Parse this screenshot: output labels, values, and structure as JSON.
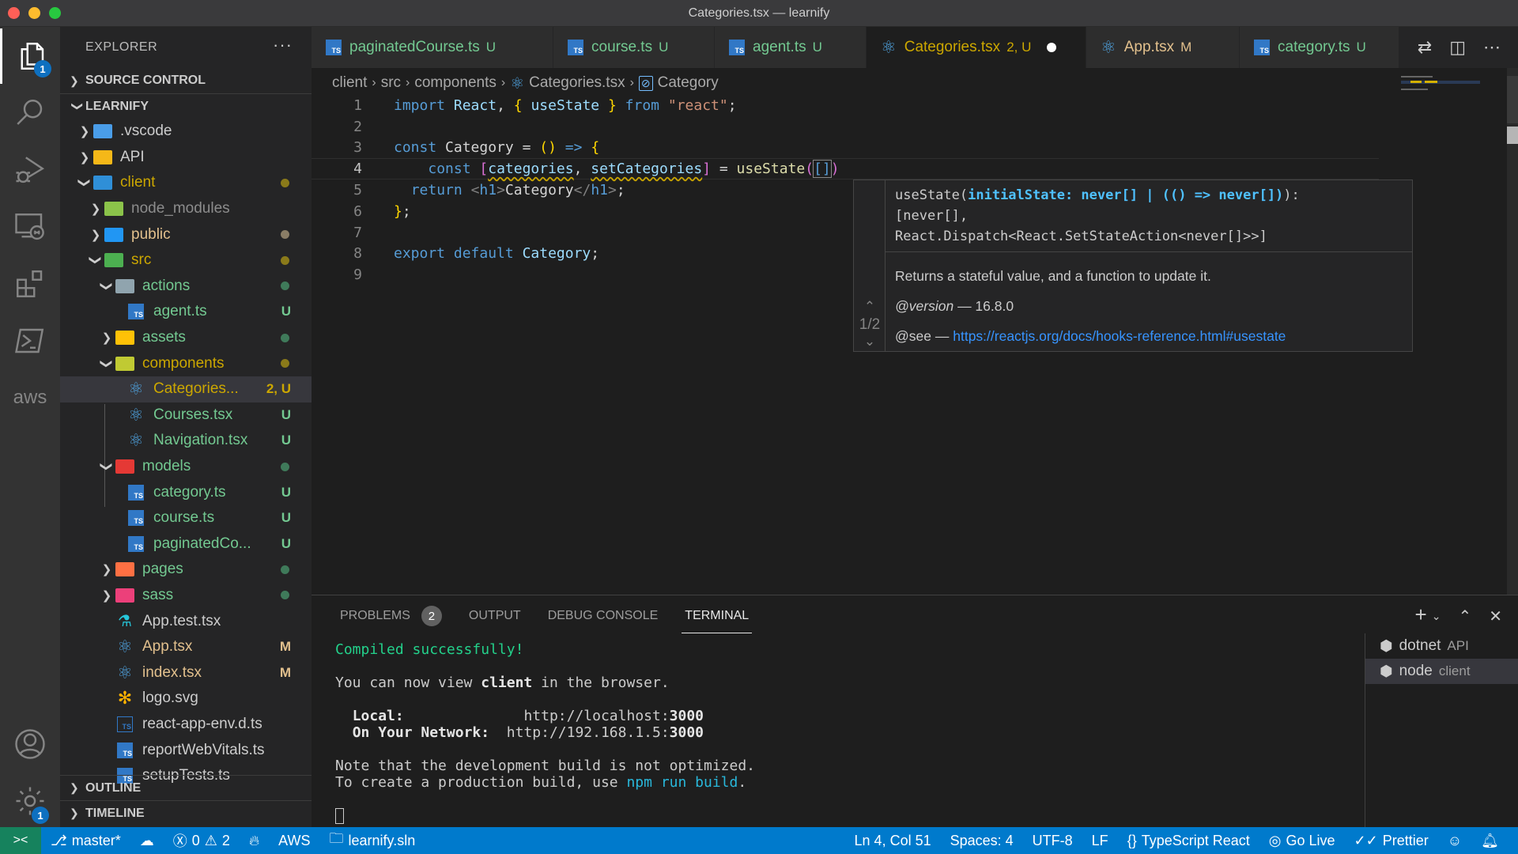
{
  "window": {
    "title": "Categories.tsx — learnify"
  },
  "activity_bar": {
    "explorer_badge": "1",
    "settings_badge": "1",
    "items": [
      "explorer",
      "search",
      "run-debug",
      "remote-explorer",
      "extensions",
      "terminal",
      "aws",
      "accounts",
      "manage"
    ]
  },
  "sidebar": {
    "title": "EXPLORER",
    "more": "···",
    "source_control": "SOURCE CONTROL",
    "project": "LEARNIFY",
    "outline": "OUTLINE",
    "timeline": "TIMELINE",
    "tree": [
      {
        "name": ".vscode",
        "deco": ""
      },
      {
        "name": "API",
        "deco": ""
      },
      {
        "name": "client",
        "deco": "dot"
      },
      {
        "name": "node_modules",
        "deco": ""
      },
      {
        "name": "public",
        "deco": "dot"
      },
      {
        "name": "src",
        "deco": "dot"
      },
      {
        "name": "actions",
        "deco": "dot"
      },
      {
        "name": "agent.ts",
        "deco": "U"
      },
      {
        "name": "assets",
        "deco": "dot"
      },
      {
        "name": "components",
        "deco": "dot"
      },
      {
        "name": "Categories...",
        "deco": "2, U"
      },
      {
        "name": "Courses.tsx",
        "deco": "U"
      },
      {
        "name": "Navigation.tsx",
        "deco": "U"
      },
      {
        "name": "models",
        "deco": "dot"
      },
      {
        "name": "category.ts",
        "deco": "U"
      },
      {
        "name": "course.ts",
        "deco": "U"
      },
      {
        "name": "paginatedCo...",
        "deco": "U"
      },
      {
        "name": "pages",
        "deco": "dot"
      },
      {
        "name": "sass",
        "deco": "dot"
      },
      {
        "name": "App.test.tsx",
        "deco": ""
      },
      {
        "name": "App.tsx",
        "deco": "M"
      },
      {
        "name": "index.tsx",
        "deco": "M"
      },
      {
        "name": "logo.svg",
        "deco": ""
      },
      {
        "name": "react-app-env.d.ts",
        "deco": ""
      },
      {
        "name": "reportWebVitals.ts",
        "deco": ""
      },
      {
        "name": "setupTests.ts",
        "deco": ""
      }
    ]
  },
  "tabs": [
    {
      "label": "paginatedCourse.ts",
      "dec": "U"
    },
    {
      "label": "course.ts",
      "dec": "U"
    },
    {
      "label": "agent.ts",
      "dec": "U"
    },
    {
      "label": "Categories.tsx",
      "dec": "2, U",
      "active": true,
      "dirty": true
    },
    {
      "label": "App.tsx",
      "dec": "M"
    },
    {
      "label": "category.ts",
      "dec": "U"
    }
  ],
  "breadcrumb": [
    "client",
    "src",
    "components",
    "Categories.tsx",
    "Category"
  ],
  "editor": {
    "line_numbers": [
      "1",
      "2",
      "3",
      "4",
      "5",
      "6",
      "7",
      "8",
      "9"
    ],
    "current_line": 4
  },
  "hover": {
    "sig_fn": "useState(",
    "sig_param": "initialState: never[] | (() => never[])",
    "sig_end": "):",
    "sig_line2": "[never[],",
    "sig_line3": "React.Dispatch<React.SetStateAction<never[]>>]",
    "description": "Returns a stateful value, and a function to update it.",
    "version_tag": "@version",
    "version_value": "— 16.8.0",
    "see_tag": "@see",
    "see_dash": "—",
    "see_link": "https://reactjs.org/docs/hooks-reference.html#usestate",
    "overload": "1/2"
  },
  "panel": {
    "tabs": [
      {
        "label": "PROBLEMS",
        "badge": "2"
      },
      {
        "label": "OUTPUT"
      },
      {
        "label": "DEBUG CONSOLE"
      },
      {
        "label": "TERMINAL",
        "active": true
      }
    ],
    "terminal": {
      "compiled": "Compiled successfully!",
      "view_pre": "You can now view ",
      "view_app": "client",
      "view_post": " in the browser.",
      "local_label": "Local:",
      "local_url_pre": "http://localhost:",
      "local_port": "3000",
      "network_label": "On Your Network:",
      "network_url_pre": "http://192.168.1.5:",
      "network_port": "3000",
      "note1": "Note that the development build is not optimized.",
      "note2_pre": "To create a production build, use ",
      "note2_cmd": "npm run build",
      "note2_post": "."
    },
    "terminals": [
      {
        "name": "dotnet",
        "sub": "API"
      },
      {
        "name": "node",
        "sub": "client",
        "selected": true
      }
    ]
  },
  "statusbar": {
    "branch": "master*",
    "errors": "0",
    "warnings": "2",
    "aws": "AWS",
    "solution": "learnify.sln",
    "position": "Ln 4, Col 51",
    "spaces": "Spaces: 4",
    "encoding": "UTF-8",
    "eol": "LF",
    "language": "TypeScript React",
    "golive": "Go Live",
    "prettier": "Prettier"
  },
  "colors": {
    "statusbar": "#007acc",
    "remote": "#16825d",
    "untracked": "#73c991",
    "modified": "#e2c08d"
  }
}
